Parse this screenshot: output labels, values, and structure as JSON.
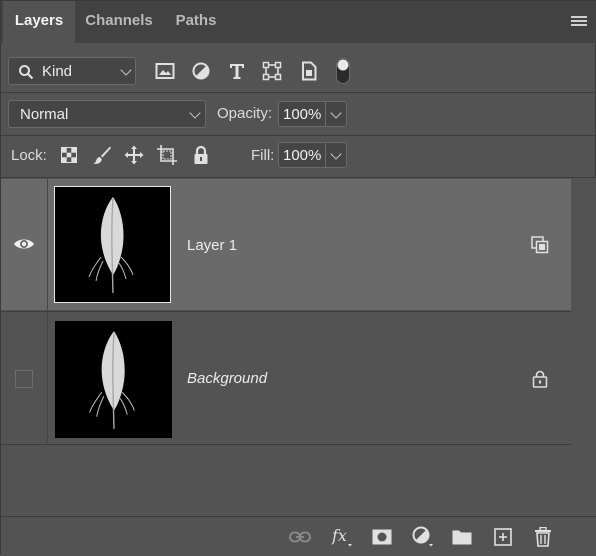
{
  "tabs": [
    {
      "label": "Layers",
      "active": true
    },
    {
      "label": "Channels",
      "active": false
    },
    {
      "label": "Paths",
      "active": false
    }
  ],
  "filter": {
    "kind_label": "Kind",
    "icons": [
      "image-filter-icon",
      "adjustment-filter-icon",
      "type-filter-icon",
      "shape-filter-icon",
      "smart-object-filter-icon",
      "filter-toggle-icon"
    ]
  },
  "blend": {
    "mode": "Normal",
    "opacity_label": "Opacity:",
    "opacity_value": "100%"
  },
  "lock": {
    "label": "Lock:",
    "fill_label": "Fill:",
    "fill_value": "100%"
  },
  "layers": [
    {
      "name": "Layer 1",
      "visible": true,
      "selected": true,
      "italic": false,
      "badge": "smart-object-icon"
    },
    {
      "name": "Background",
      "visible": false,
      "selected": false,
      "italic": true,
      "badge": "lock-icon"
    }
  ],
  "colors": {
    "panel_bg": "#535353",
    "tab_strip_bg": "#424242",
    "selected_row_bg": "#6a6a6a"
  }
}
